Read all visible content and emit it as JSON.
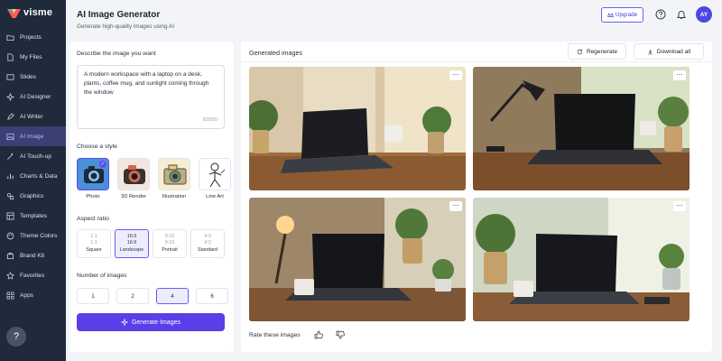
{
  "app": {
    "logo_text": "visme"
  },
  "sidebar": {
    "items": [
      {
        "label": "Projects",
        "icon": "folder-icon"
      },
      {
        "label": "My Files",
        "icon": "file-icon"
      },
      {
        "label": "Slides",
        "icon": "slides-icon"
      },
      {
        "label": "AI Designer",
        "icon": "sparkle-icon"
      },
      {
        "label": "AI Writer",
        "icon": "pen-icon"
      },
      {
        "label": "AI Image",
        "icon": "image-icon",
        "active": true
      },
      {
        "label": "AI Touch-up",
        "icon": "wand-icon"
      },
      {
        "label": "Charts & Data",
        "icon": "chart-icon"
      },
      {
        "label": "Graphics",
        "icon": "graphics-icon"
      },
      {
        "label": "Templates",
        "icon": "template-icon"
      },
      {
        "label": "Theme Colors",
        "icon": "palette-icon"
      },
      {
        "label": "Brand Kit",
        "icon": "brand-icon"
      },
      {
        "label": "Favorites",
        "icon": "star-icon"
      },
      {
        "label": "Apps",
        "icon": "apps-icon"
      }
    ],
    "help_label": "?"
  },
  "header": {
    "title": "AI Image Generator",
    "subtitle": "Generate high-quality images using AI",
    "upgrade_label": "Upgrade",
    "avatar_initials": "AY"
  },
  "form": {
    "prompt_label": "Describe the image you want",
    "prompt_value": "A modern workspace with a laptop on a desk, plants, coffee mug, and sunlight coming through the window",
    "char_count": "82/500",
    "style_label": "Choose a style",
    "styles": [
      {
        "label": "Photo",
        "selected": true
      },
      {
        "label": "3D Render"
      },
      {
        "label": "Illustration"
      },
      {
        "label": "Line Art"
      }
    ],
    "aspect_label": "Aspect ratio",
    "aspects": [
      {
        "top": "1:1",
        "bottom": "1:1",
        "label": "Square"
      },
      {
        "top": "16:9",
        "bottom": "16:9",
        "label": "Landscape",
        "selected": true
      },
      {
        "top": "9:16",
        "bottom": "9:16",
        "label": "Portrait"
      },
      {
        "top": "4:3",
        "bottom": "4:3",
        "label": "Standard"
      }
    ],
    "count_label": "Number of images",
    "counts": [
      "1",
      "2",
      "4",
      "6"
    ],
    "selected_count": "4",
    "generate_label": "Generate Images"
  },
  "results": {
    "title": "Generated images",
    "regenerate_label": "Regenerate",
    "download_label": "Download all",
    "more_label": "⋯",
    "rate_label": "Rate these images"
  },
  "colors": {
    "accent": "#5b3ee8",
    "sidebar_bg": "#1f2a3b",
    "active_nav": "#3b3f72"
  }
}
